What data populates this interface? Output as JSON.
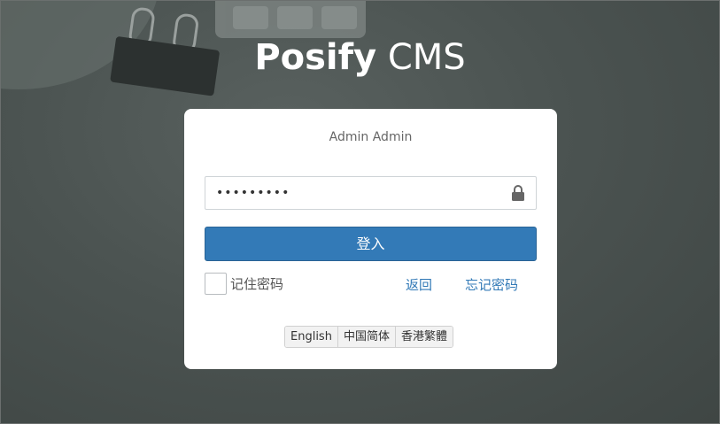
{
  "header": {
    "brand": "Posify",
    "suffix": "CMS"
  },
  "login": {
    "username": "Admin Admin",
    "password_value": "•••••••••",
    "password_icon": "lock-icon",
    "submit_label": "登入",
    "remember_label": "记住密码",
    "back_label": "返回",
    "forgot_label": "忘记密码"
  },
  "languages": [
    {
      "label": "English"
    },
    {
      "label": "中国简体"
    },
    {
      "label": "香港繁體"
    }
  ],
  "colors": {
    "primary": "#337ab7",
    "background": "#4a5250",
    "card": "#ffffff"
  }
}
